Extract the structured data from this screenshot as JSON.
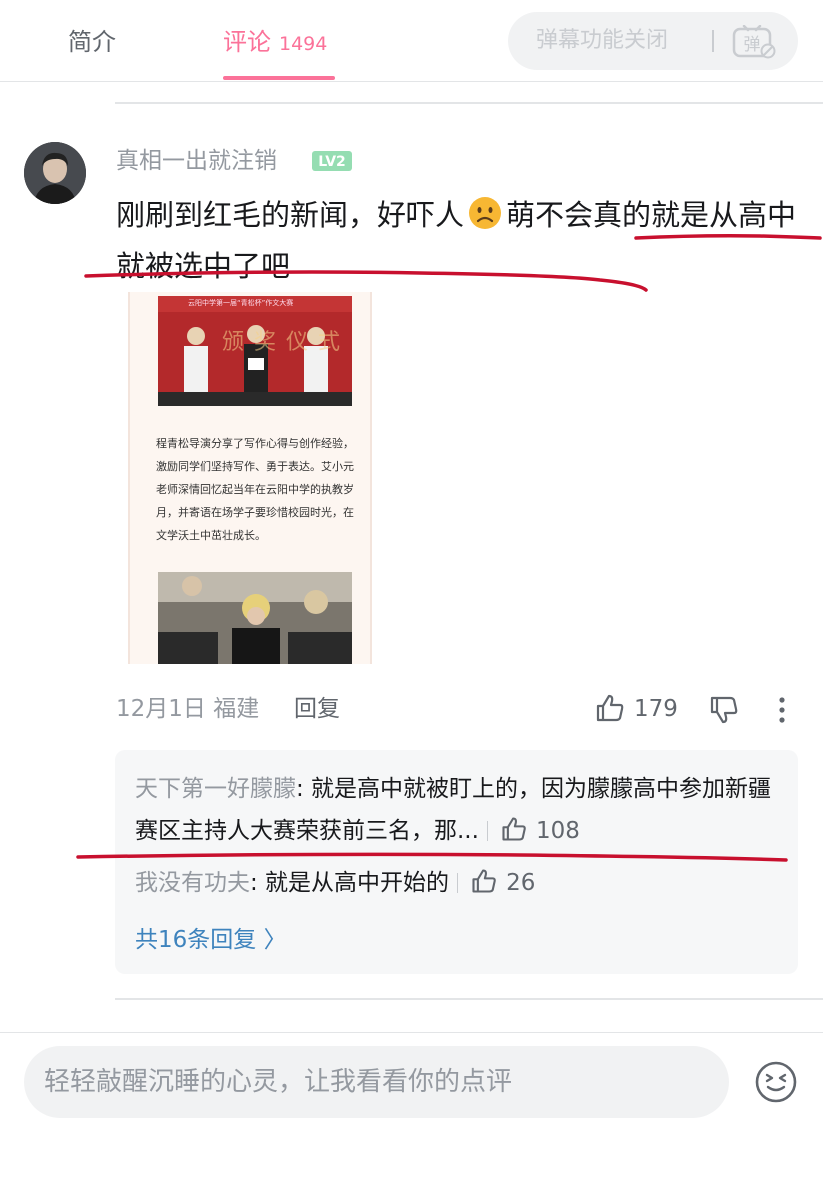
{
  "tabs": {
    "intro_label": "简介",
    "comments_label": "评论",
    "comments_count": "1494"
  },
  "danmaku": {
    "label": "弹幕功能关闭",
    "icon_char": "弹"
  },
  "comment": {
    "username": "真相一出就注销",
    "level": "LV2",
    "text_part1": "刚刷到红毛的新闻，好吓人",
    "text_part2": "萌不会真的就是从高中就被选中了吧",
    "emoji": "worried-face",
    "image": {
      "banner_caption": "云阳中学第一届“青松杯”作文大赛",
      "banner_text": "颁奖仪式",
      "paragraph": "程青松导演分享了写作心得与创作经验，激励同学们坚持写作、勇于表达。艾小元老师深情回忆起当年在云阳中学的执教岁月，并寄语在场学子要珍惜校园时光，在文学沃土中茁壮成长。"
    },
    "date_location": "12月1日 福建",
    "reply_label": "回复",
    "likes": "179"
  },
  "replies": [
    {
      "user": "天下第一好朦朦",
      "text": ": 就是高中就被盯上的，因为朦朦高中参加新疆赛区主持人大赛荣获前三名，那...",
      "likes": "108"
    },
    {
      "user": "我没有功夫",
      "text": ": 就是从高中开始的",
      "likes": "26"
    }
  ],
  "view_all_replies": "共16条回复 〉",
  "input": {
    "placeholder": "轻轻敲醒沉睡的心灵，让我看看你的点评"
  },
  "colors": {
    "accent_pink": "#fb7299",
    "link_blue": "#3e83bd",
    "level_green": "#95ddb2",
    "annotation_red": "#c8102e"
  }
}
